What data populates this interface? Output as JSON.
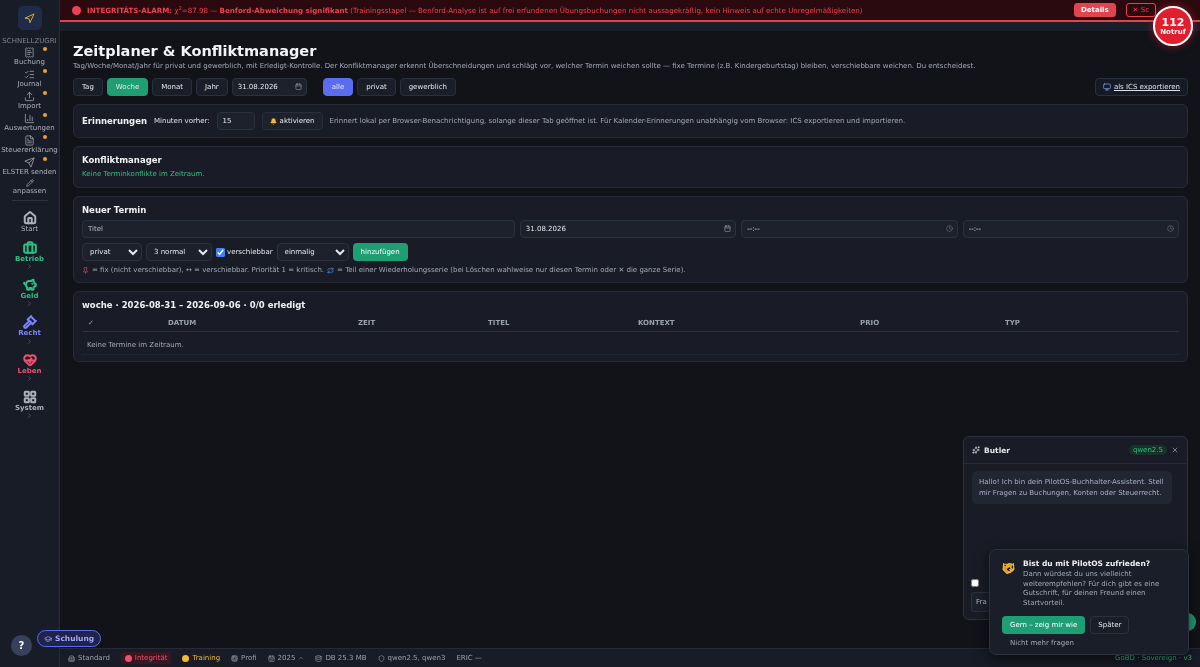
{
  "alarm": {
    "text": "**INTEGRITÄTS-ALARM:** χ$^{2}$=87.98 — **Benford-Abweichung signifikant** (Trainingsstapel — Benford-Analyse ist auf frei erfundenen Übungsbuchungen nicht aussagekräftig, kein Hinweis auf echte Unregelmäßigkeiten)",
    "details": "Details",
    "close": "✕ Sc"
  },
  "emergency": {
    "number": "112",
    "label": "Notruf"
  },
  "sidebar": {
    "section": "SCHNELLZUGRI",
    "quick": [
      {
        "label": "Buchung",
        "starred": true
      },
      {
        "label": "Journal",
        "starred": true
      },
      {
        "label": "Import",
        "starred": true
      },
      {
        "label": "Auswertungen",
        "starred": true
      },
      {
        "label": "Steuererklärung",
        "starred": true
      },
      {
        "label": "ELSTER senden",
        "starred": true
      }
    ],
    "customize": "anpassen",
    "groups": [
      {
        "label": "Start",
        "kind": "link",
        "color": "#aab0bd"
      },
      {
        "label": "Betrieb",
        "kind": "group",
        "color": "#2fbf83"
      },
      {
        "label": "Geld",
        "kind": "group",
        "color": "#2fbf83"
      },
      {
        "label": "Recht",
        "kind": "group",
        "color": "#7b83ff"
      },
      {
        "label": "Leben",
        "kind": "group",
        "color": "#f0506e"
      },
      {
        "label": "System",
        "kind": "group",
        "color": "#aab0bd"
      }
    ]
  },
  "page": {
    "title": "Zeitplaner & Konfliktmanager",
    "description": "Tag/Woche/Monat/Jahr für privat und gewerblich, mit Erledigt-Kontrolle. Der Konfliktmanager erkennt Überschneidungen und schlägt vor, welcher Termin weichen sollte — fixe Termine (z.B. Kindergeburtstag) bleiben, verschiebbare weichen. Du entscheidest."
  },
  "views": [
    {
      "label": "Tag",
      "selected": false
    },
    {
      "label": "Woche",
      "selected": true
    },
    {
      "label": "Monat",
      "selected": false
    },
    {
      "label": "Jahr",
      "selected": false
    }
  ],
  "date": "31.08.2026",
  "filters": [
    {
      "label": "alle",
      "selected": true
    },
    {
      "label": "privat",
      "selected": false
    },
    {
      "label": "gewerblich",
      "selected": false
    }
  ],
  "export": "als ICS exportieren",
  "reminders": {
    "title": "Erinnerungen",
    "minutes_label": "Minuten vorher:",
    "minutes": "15",
    "button": "aktivieren",
    "hint": "Erinnert lokal per Browser-Benachrichtigung, solange dieser Tab geöffnet ist. Für Kalender-Erinnerungen unabhängig vom Browser: ICS exportieren und importieren."
  },
  "conflicts": {
    "title": "Konfliktmanager",
    "message": "Keine Terminkonflikte im Zeitraum."
  },
  "new_event": {
    "title": "Neuer Termin",
    "title_placeholder": "Titel",
    "date": "31.08.2026",
    "start": "--:--",
    "end": "--:--",
    "context": "privat",
    "priority": "3 normal",
    "movable": {
      "label": "verschiebbar",
      "checked": true
    },
    "repeat": "einmalig",
    "submit": "hinzufügen",
    "legend": [
      {
        "kind": "pin",
        "text": "= fix (nicht verschiebbar), ↔ = verschiebbar. Priorität 1 = kritisch."
      },
      {
        "kind": "repeat",
        "text": "= Teil einer Wiederholungsserie (bei Löschen wahlweise nur diesen Termin oder ✕ die ganze Serie)."
      }
    ]
  },
  "table": {
    "title": "woche · 2026-08-31 – 2026-09-06 · 0/0 erledigt",
    "columns": [
      "✓",
      "DATUM",
      "ZEIT",
      "TITEL",
      "KONTEXT",
      "PRIO",
      "TYP"
    ],
    "empty": "Keine Termine im Zeitraum."
  },
  "status_bar": [
    {
      "label": "Standard",
      "kind": "plain"
    },
    {
      "label": "Integrität",
      "kind": "alert",
      "color": "#f0506e"
    },
    {
      "label": "Training",
      "kind": "dot",
      "color": "#f5b82e"
    },
    {
      "label": "Profi",
      "kind": "plain"
    },
    {
      "label": "2025",
      "kind": "plain"
    },
    {
      "label": "DB 25.3 MB",
      "kind": "plain"
    },
    {
      "label": "qwen2.5, qwen3",
      "kind": "plain"
    },
    {
      "label": "ERIC —",
      "kind": "plain"
    }
  ],
  "status_right": "GoBD · Sovereign · v3",
  "training_button": "Schulung",
  "help_button": "?",
  "butler": {
    "title": "Butler",
    "model": "qwen2.5",
    "message": "Hallo! Ich bin dein PilotOS-Buchhalter-Assistent. Stell mir Fragen zu Buchungen, Konten oder Steuerrecht.",
    "option_checked": false,
    "input_placeholder": "Fra"
  },
  "feedback": {
    "title": "Bist du mit PilotOS zufrieden?",
    "text": "Dann würdest du uns vielleicht weiterempfehlen? Für dich gibt es eine Gutschrift, für deinen Freund einen Startvorteil.",
    "accept": "Gern – zeig mir wie",
    "later": "Später",
    "never": "Nicht mehr fragen"
  }
}
